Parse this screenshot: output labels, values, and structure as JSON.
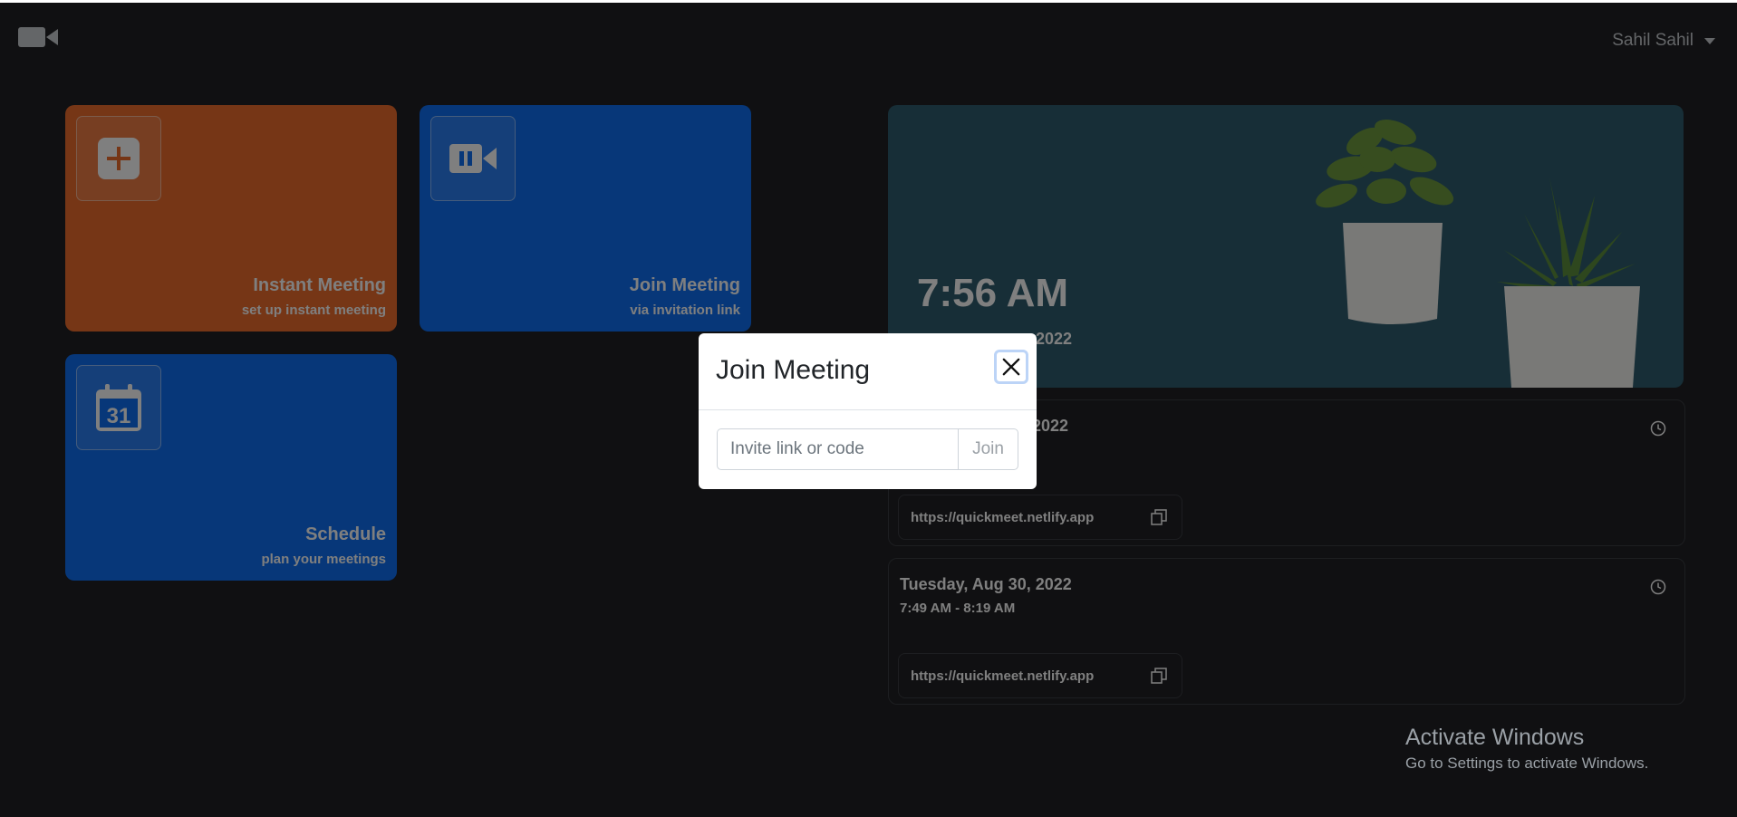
{
  "header": {
    "logo_icon": "video-camera-icon",
    "user_name": "Sahil Sahil"
  },
  "tiles": {
    "instant": {
      "title": "Instant Meeting",
      "subtitle": "set up instant meeting",
      "icon": "plus-icon",
      "color": "#ed6c2c"
    },
    "join": {
      "title": "Join Meeting",
      "subtitle": "via invitation link",
      "icon": "video-camera-icon",
      "color": "#0e6ef2"
    },
    "schedule": {
      "title": "Schedule",
      "subtitle": "plan your meetings",
      "icon": "calendar-icon",
      "calendar_day": "31",
      "color": "#0e6ef2"
    }
  },
  "hero": {
    "time": "7:56 AM",
    "date": ", 2022"
  },
  "meetings": [
    {
      "date": "2022",
      "time": "",
      "link": "https://quickmeet.netlify.app"
    },
    {
      "date": "Tuesday, Aug 30, 2022",
      "time": "7:49 AM - 8:19 AM",
      "link": "https://quickmeet.netlify.app"
    }
  ],
  "modal": {
    "title": "Join Meeting",
    "input_placeholder": "Invite link or code",
    "input_value": "",
    "join_label": "Join"
  },
  "watermark": {
    "title": "Activate Windows",
    "subtitle": "Go to Settings to activate Windows."
  }
}
